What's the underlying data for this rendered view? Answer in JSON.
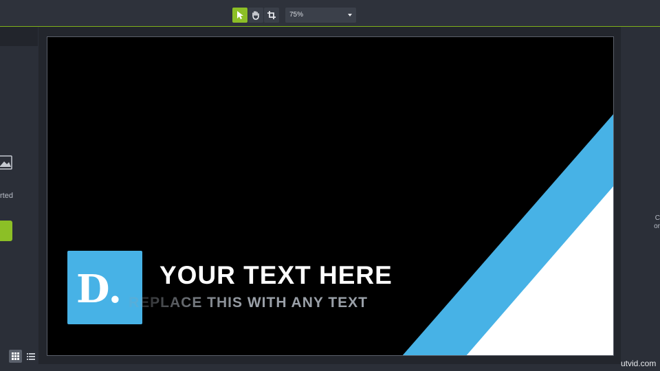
{
  "toolbar": {
    "zoom_value": "75%",
    "tools": [
      {
        "name": "select",
        "icon": "arrow-pointer-icon",
        "active": true
      },
      {
        "name": "pan",
        "icon": "hand-icon",
        "active": false
      },
      {
        "name": "crop",
        "icon": "crop-icon",
        "active": false
      }
    ]
  },
  "left_panel": {
    "partial_label": "rted",
    "icon": "image-icon",
    "view_buttons": [
      {
        "icon": "grid-view-icon",
        "active": true
      },
      {
        "icon": "list-view-icon",
        "active": false
      }
    ]
  },
  "right_panel": {
    "partial_line1": "C",
    "partial_line2": "or"
  },
  "preview": {
    "logo_letter": "D.",
    "title": "YOUR TEXT HERE",
    "subtitle": "REPLACE THIS WITH ANY TEXT",
    "colors": {
      "background": "#000000",
      "accent_blue": "#47b2e6",
      "white": "#ffffff"
    }
  },
  "watermark": "utvid.com",
  "colors": {
    "accent_green": "#8cbf26",
    "panel": "#2b2f38"
  }
}
